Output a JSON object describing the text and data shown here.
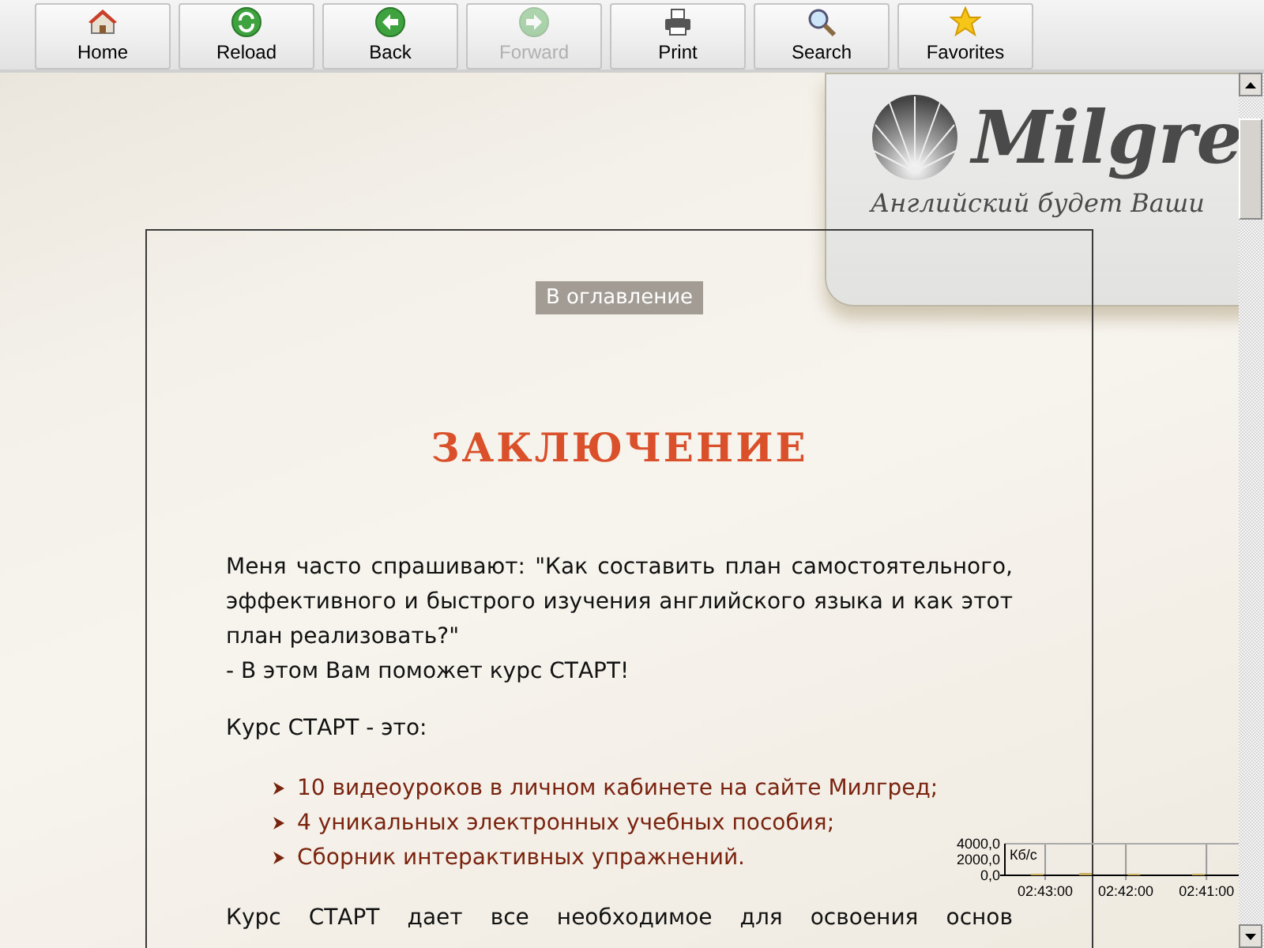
{
  "toolbar": [
    {
      "kind": "home",
      "label": "Home",
      "disabled": false
    },
    {
      "kind": "reload",
      "label": "Reload",
      "disabled": false
    },
    {
      "kind": "back",
      "label": "Back",
      "disabled": false
    },
    {
      "kind": "forward",
      "label": "Forward",
      "disabled": true
    },
    {
      "kind": "print",
      "label": "Print",
      "disabled": false
    },
    {
      "kind": "search",
      "label": "Search",
      "disabled": false
    },
    {
      "kind": "favorites",
      "label": "Favorites",
      "disabled": false
    }
  ],
  "logo": {
    "name": "Milgre",
    "tagline": "Английский будет Ваши"
  },
  "content": {
    "toc_link": "В оглавление",
    "title": "ЗАКЛЮЧЕНИЕ",
    "intro": "Меня часто спрашивают: \"Как составить план самостоятельного, эффективного и быстрого изучения английского языка и как этот план реализовать?\"",
    "intro_answer": "- В этом Вам поможет курс СТАРТ!",
    "list_heading": "Курс СТАРТ - это:",
    "list": [
      "10 видеоуроков в личном кабинете на сайте Милгред;",
      "4 уникальных электронных учебных пособия;",
      "Сборник интерактивных упражнений."
    ],
    "closing": "Курс СТАРТ дает все необходимое для освоения основ"
  },
  "traffic_monitor": {
    "chart_data": {
      "type": "bar",
      "ylabel": "Кб/с",
      "x": [
        163.1,
        162.5,
        161.9,
        161.1
      ],
      "series": [
        {
          "color": "#c8b060",
          "values": [
            200,
            300,
            200,
            200
          ]
        }
      ],
      "xlim": [
        163.5,
        160.6
      ],
      "xticks": [
        {
          "value": 163,
          "label": "02:43:00"
        },
        {
          "value": 162,
          "label": "02:42:00"
        },
        {
          "value": 161,
          "label": "02:41:00"
        }
      ],
      "ylim": [
        0,
        4000
      ],
      "yticks": [
        {
          "value": 0,
          "label": "0,0"
        },
        {
          "value": 2000,
          "label": "2000,0"
        },
        {
          "value": 4000,
          "label": "4000,0"
        }
      ]
    }
  }
}
